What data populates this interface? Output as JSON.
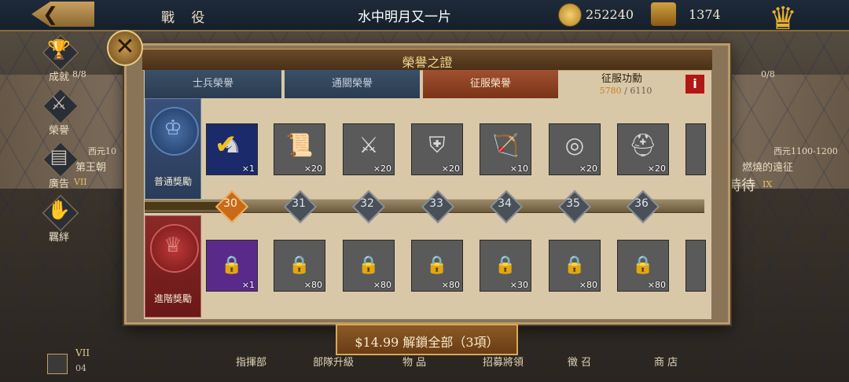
{
  "header": {
    "left_title": "戰 役",
    "center_title": "水中明月又一片",
    "gold": "252240",
    "medals": "1374"
  },
  "sidebar": {
    "items": [
      {
        "label": "成就",
        "icon": "trophy-icon"
      },
      {
        "label": "榮譽",
        "icon": "helmet-icon"
      },
      {
        "label": "廣告",
        "icon": "film-icon"
      },
      {
        "label": "羈絆",
        "icon": "handshake-icon"
      }
    ]
  },
  "background_labels": {
    "left_progress": "8/8",
    "left_era": "西元10",
    "left_name": "第王朝",
    "left_roman": "VII",
    "right_progress": "0/8",
    "right_era": "西元1100-1200",
    "right_name": "燃燒的遠征",
    "right_roman": "IX",
    "right_cut": "時待"
  },
  "modal": {
    "title": "榮譽之證",
    "close_icon": "close-icon",
    "tabs": [
      {
        "label": "士兵榮譽",
        "active": false
      },
      {
        "label": "通關榮譽",
        "active": false
      },
      {
        "label": "征服榮譽",
        "active": true
      }
    ],
    "conquest": {
      "label": "征服功勳",
      "current": "5780",
      "separator": "/",
      "max": "6110"
    },
    "normal_reward": {
      "label": "普通獎勵",
      "items": [
        {
          "icon": "horse-icon",
          "qty": "×1",
          "claimed": true
        },
        {
          "icon": "scroll-icon",
          "qty": "×20"
        },
        {
          "icon": "sword-icon",
          "qty": "×20"
        },
        {
          "icon": "armor-icon",
          "qty": "×20"
        },
        {
          "icon": "archer-icon",
          "qty": "×10"
        },
        {
          "icon": "target-icon",
          "qty": "×20"
        },
        {
          "icon": "helmet-icon",
          "qty": "×20"
        }
      ]
    },
    "advanced_reward": {
      "label": "進階獎勵",
      "items": [
        {
          "icon": "lock-icon",
          "qty": "×1"
        },
        {
          "icon": "lock-icon",
          "qty": "×80"
        },
        {
          "icon": "lock-icon",
          "qty": "×80"
        },
        {
          "icon": "lock-icon",
          "qty": "×80"
        },
        {
          "icon": "lock-icon",
          "qty": "×30"
        },
        {
          "icon": "lock-icon",
          "qty": "×80"
        },
        {
          "icon": "lock-icon",
          "qty": "×80"
        }
      ]
    },
    "levels": [
      {
        "num": "30",
        "done": true
      },
      {
        "num": "31",
        "done": false
      },
      {
        "num": "32",
        "done": false
      },
      {
        "num": "33",
        "done": false
      },
      {
        "num": "34",
        "done": false
      },
      {
        "num": "35",
        "done": false
      },
      {
        "num": "36",
        "done": false
      }
    ],
    "progress_fraction": 0.15,
    "unlock_button": "$14.99 解鎖全部（3項）"
  },
  "bottom_nav": {
    "save_top": "VII",
    "save_bottom": "04",
    "items": [
      "指揮部",
      "部隊升級",
      "物 品",
      "招募將領",
      "徵 召",
      "商 店"
    ]
  },
  "colors": {
    "accent_orange": "#c86a1a",
    "tab_active": "#a05030",
    "tab_inactive": "#3a5068",
    "conq_current": "#c8801a"
  }
}
